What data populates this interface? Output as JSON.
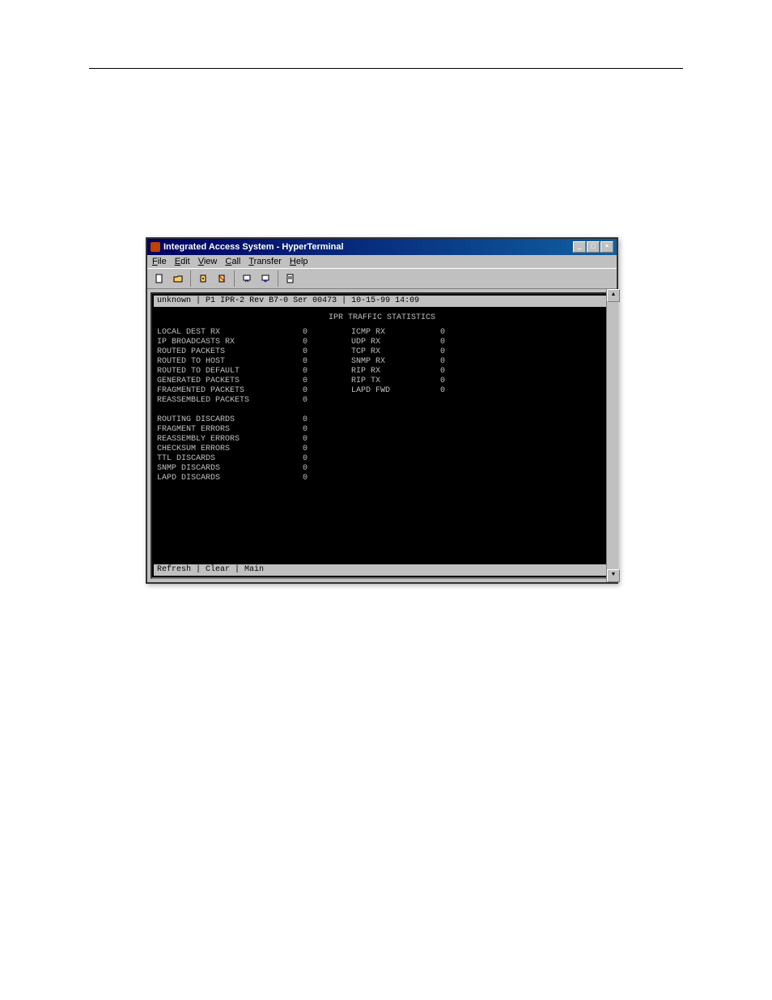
{
  "window": {
    "title": "Integrated Access System - HyperTerminal",
    "controls": {
      "min": "_",
      "max": "□",
      "close": "×"
    }
  },
  "menubar": {
    "file": "File",
    "edit": "Edit",
    "view": "View",
    "call": "Call",
    "transfer": "Transfer",
    "help": "Help"
  },
  "term_header": {
    "host": "unknown",
    "slot": "| P1",
    "card": "IPR-2",
    "rev": "Rev B7-0",
    "ser": "Ser 00473",
    "datetime": "| 10-15-99 14:09"
  },
  "term_title": "IPR TRAFFIC STATISTICS",
  "stats_left_a": [
    {
      "label": "LOCAL DEST RX",
      "val": "0",
      "r_label": "ICMP RX",
      "r_val": "0"
    },
    {
      "label": "IP BROADCASTS RX",
      "val": "0",
      "r_label": "UDP RX",
      "r_val": "0"
    },
    {
      "label": "ROUTED PACKETS",
      "val": "0",
      "r_label": "TCP RX",
      "r_val": "0"
    },
    {
      "label": "ROUTED TO HOST",
      "val": "0",
      "r_label": "SNMP RX",
      "r_val": "0"
    },
    {
      "label": "ROUTED TO DEFAULT",
      "val": "0",
      "r_label": "RIP RX",
      "r_val": "0"
    },
    {
      "label": "GENERATED PACKETS",
      "val": "0",
      "r_label": "RIP TX",
      "r_val": "0"
    },
    {
      "label": "FRAGMENTED PACKETS",
      "val": "0",
      "r_label": "LAPD FWD",
      "r_val": "0"
    },
    {
      "label": "REASSEMBLED PACKETS",
      "val": "0",
      "r_label": "",
      "r_val": ""
    }
  ],
  "stats_left_b": [
    {
      "label": "ROUTING DISCARDS",
      "val": "0"
    },
    {
      "label": "FRAGMENT ERRORS",
      "val": "0"
    },
    {
      "label": "REASSEMBLY ERRORS",
      "val": "0"
    },
    {
      "label": "CHECKSUM ERRORS",
      "val": "0"
    },
    {
      "label": "TTL DISCARDS",
      "val": "0"
    },
    {
      "label": "SNMP DISCARDS",
      "val": "0"
    },
    {
      "label": "LAPD DISCARDS",
      "val": "0"
    }
  ],
  "term_footer": "Refresh | Clear | Main"
}
